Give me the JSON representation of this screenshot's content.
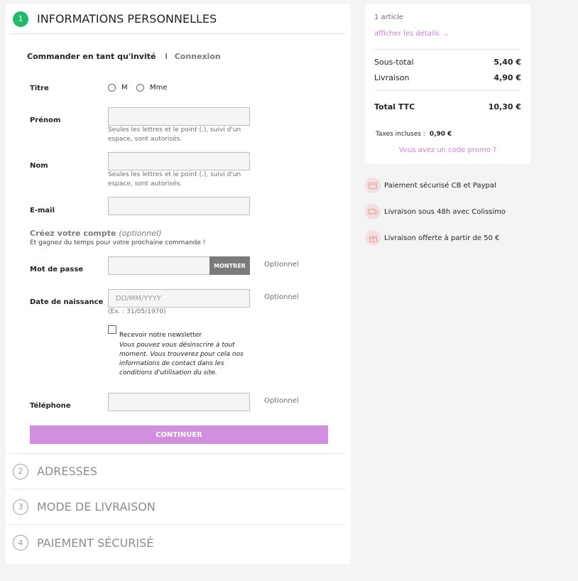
{
  "step1": {
    "number": "1",
    "title": "INFORMATIONS PERSONNELLES"
  },
  "login": {
    "guest": "Commander en tant qu'invité",
    "separator": "I",
    "login_link": "Connexion"
  },
  "form": {
    "titre_label": "Titre",
    "radio_m": "M",
    "radio_mme": "Mme",
    "prenom_label": "Prénom",
    "prenom_hint": "Seules les lettres et le point (.), suivi d'un espace, sont autorisés.",
    "nom_label": "Nom",
    "nom_hint": "Seules les lettres et le point (.), suivi d'un espace, sont autorisés.",
    "email_label": "E-mail",
    "create_title": "Créez votre compte",
    "create_optional": "(optionnel)",
    "create_sub": "Et gagnez du temps pour votre prochaine commande !",
    "password_label": "Mot de passe",
    "show_button": "MONTRER",
    "optional": "Optionnel",
    "birth_label": "Date de naissance",
    "birth_placeholder": "DD/MM/YYYY",
    "birth_hint": "(Ex. : 31/05/1970)",
    "newsletter_label": "Recevoir notre newsletter",
    "newsletter_text": "Vous pouvez vous désinscrire à tout moment. Vous trouverez pour cela nos informations de contact dans les conditions d'utilisation du site.",
    "phone_label": "Téléphone",
    "continue_button": "CONTINUER"
  },
  "steps": [
    {
      "number": "2",
      "title": "ADRESSES"
    },
    {
      "number": "3",
      "title": "MODE DE LIVRAISON"
    },
    {
      "number": "4",
      "title": "PAIEMENT SÉCURISÉ"
    }
  ],
  "summary": {
    "count": "1 article",
    "details_link": "afficher les détails",
    "subtotal_label": "Sous-total",
    "subtotal_value": "5,40 €",
    "shipping_label": "Livraison",
    "shipping_value": "4,90 €",
    "total_label": "Total TTC",
    "total_value": "10,30 €",
    "taxes_label": "Taxes incluses :",
    "taxes_value": "0,90 €",
    "promo_link": "Vous avez un code promo ?"
  },
  "reassurance": [
    {
      "icon": "credit-card-icon",
      "text": "Paiement sécurisé CB et Paypal"
    },
    {
      "icon": "truck-icon",
      "text": "Livraison sous 48h avec Colissimo"
    },
    {
      "icon": "gift-icon",
      "text": "Livraison offerte à partir de 50 €"
    }
  ],
  "colors": {
    "accent": "#d38fdf",
    "step_active": "#1fbd6b",
    "link": "#cf7fd7"
  }
}
